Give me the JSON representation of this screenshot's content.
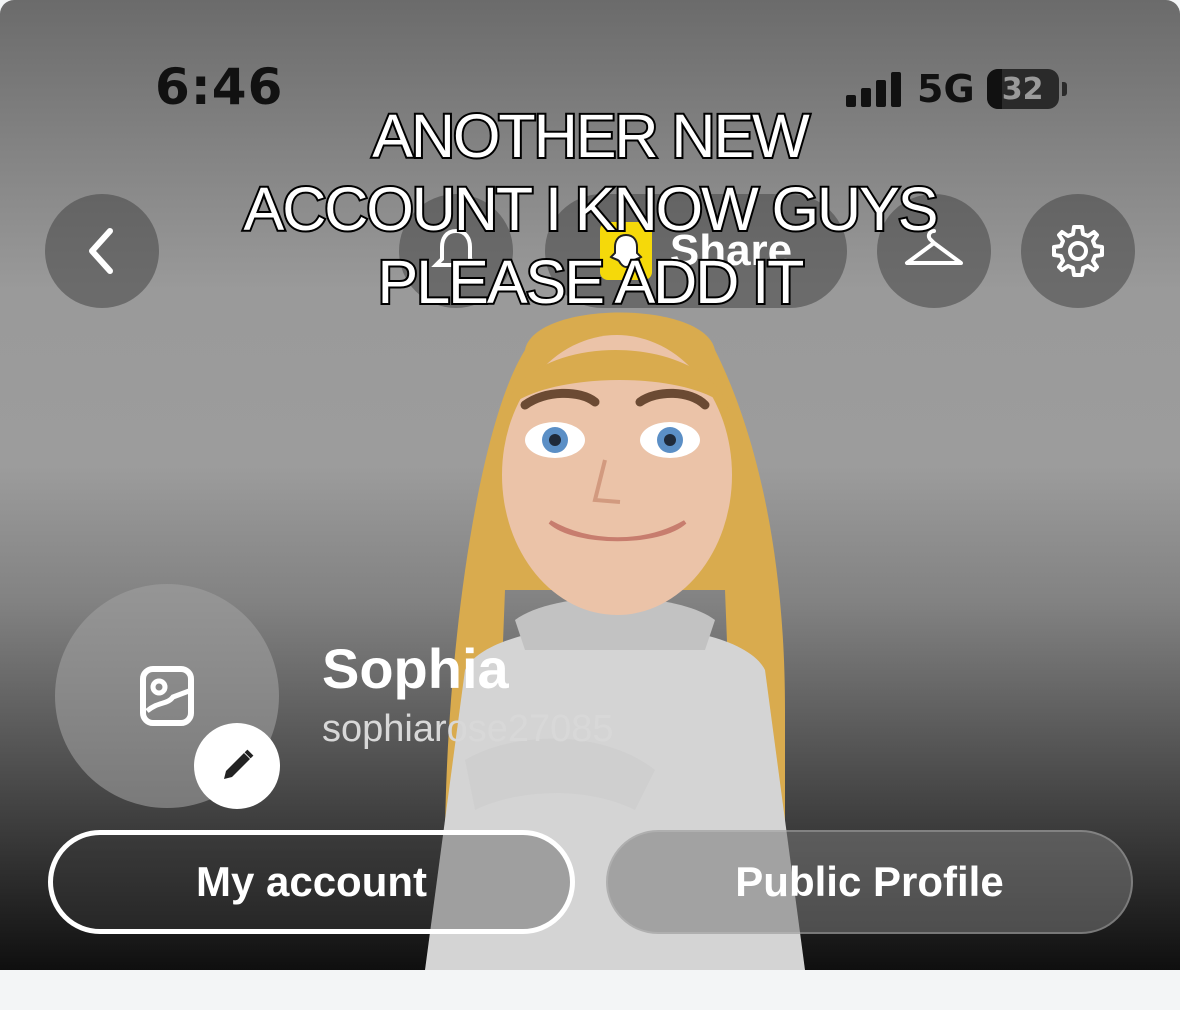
{
  "status_bar": {
    "time": "6:46",
    "network": "5G",
    "battery": "32"
  },
  "header": {
    "back_icon": "chevron-left-icon",
    "notification_icon": "bell-icon",
    "share_label": "Share",
    "wardrobe_icon": "hanger-icon",
    "settings_icon": "gear-icon"
  },
  "caption": {
    "line1": "ANOTHER NEW",
    "line2": "ACCOUNT I KNOW GUYS",
    "line3": "PLEASE ADD IT"
  },
  "profile": {
    "display_name": "Sophia",
    "username": "sophiarose27085"
  },
  "buttons": {
    "my_account": "My account",
    "public_profile": "Public Profile"
  },
  "colors": {
    "snapcode_yellow": "#f5d90a"
  }
}
